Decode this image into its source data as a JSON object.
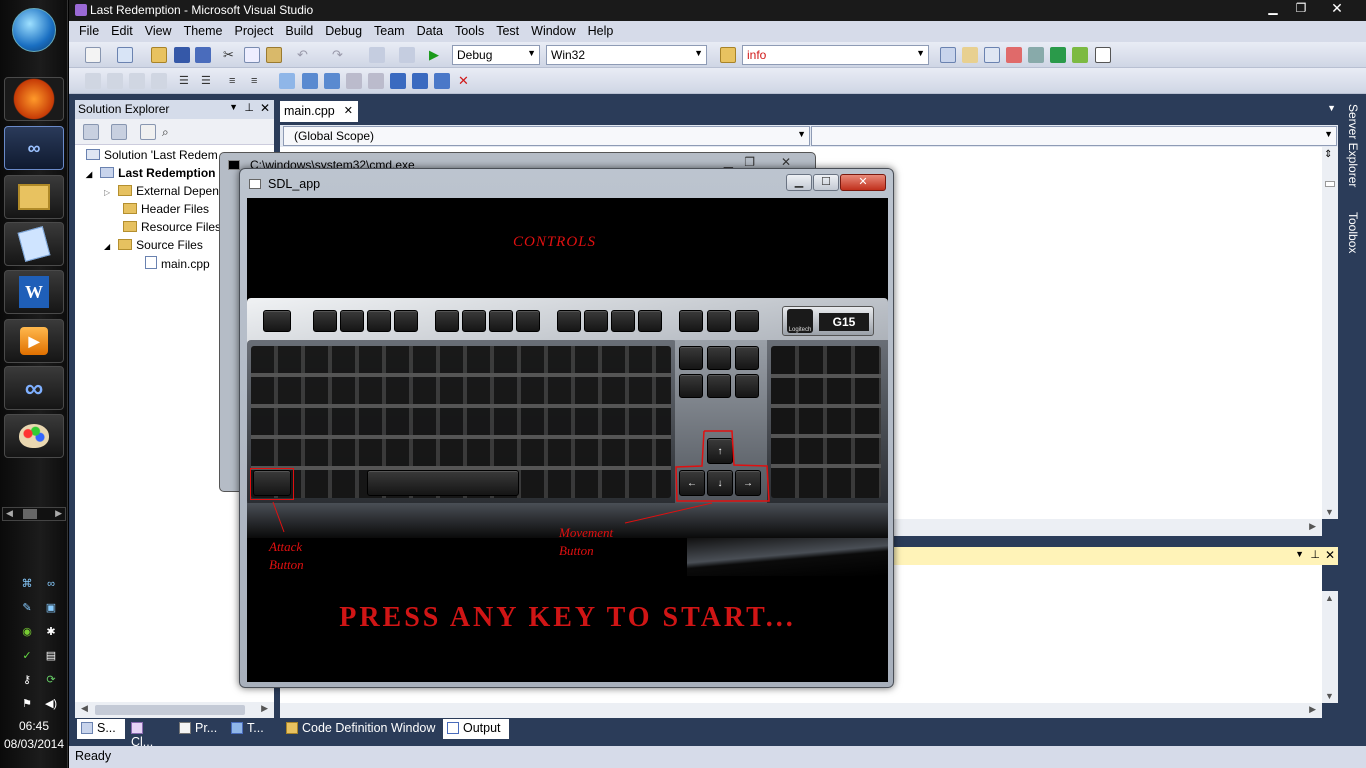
{
  "taskbar": {
    "clock_time": "06:45",
    "clock_date": "08/03/2014",
    "apps": [
      {
        "icon": "windows-start-icon"
      },
      {
        "icon": "firefox-icon"
      },
      {
        "icon": "visual-studio-icon"
      },
      {
        "icon": "file-explorer-icon"
      },
      {
        "icon": "notepad-icon"
      },
      {
        "icon": "word-icon",
        "glyph": "W"
      },
      {
        "icon": "media-player-icon"
      },
      {
        "icon": "infinity-app-icon"
      },
      {
        "icon": "paint-icon"
      }
    ]
  },
  "window": {
    "title": "Last Redemption - Microsoft Visual Studio"
  },
  "menu": [
    "File",
    "Edit",
    "View",
    "Theme",
    "Project",
    "Build",
    "Debug",
    "Team",
    "Data",
    "Tools",
    "Test",
    "Window",
    "Help"
  ],
  "toolbar": {
    "config": "Debug",
    "platform": "Win32",
    "find_value": "info"
  },
  "solution_explorer": {
    "title": "Solution Explorer",
    "items": [
      {
        "label": "Solution 'Last Redem"
      },
      {
        "label": "Last Redemption"
      },
      {
        "label": "External Depen"
      },
      {
        "label": "Header Files"
      },
      {
        "label": "Resource Files"
      },
      {
        "label": "Source Files"
      },
      {
        "label": "main.cpp"
      }
    ]
  },
  "editor": {
    "tab": "main.cpp",
    "scope": "(Global Scope)"
  },
  "right_dock": {
    "server_explorer": "Server Explorer",
    "toolbox": "Toolbox"
  },
  "bottom_tabs": {
    "left": [
      "S...",
      "Cl...",
      "Pr...",
      "T..."
    ],
    "code_definition": "Code Definition Window",
    "output": "Output"
  },
  "status": {
    "text": "Ready"
  },
  "cmd_window": {
    "title": "C:\\windows\\system32\\cmd.exe"
  },
  "sdl_window": {
    "title": "SDL_app",
    "controls_label": "CONTROLS",
    "attack_label": "Attack Button",
    "movement_label": "Movement Button",
    "prompt": "PRESS ANY KEY TO START...",
    "keyboard_brand": "G15",
    "keyboard_maker": "Logitech",
    "annotation_color": "#e01010"
  },
  "colors": {
    "vs_frame": "#2b3c59",
    "menu_bg": "#d6dbe9",
    "output_header": "#fff3b8"
  }
}
